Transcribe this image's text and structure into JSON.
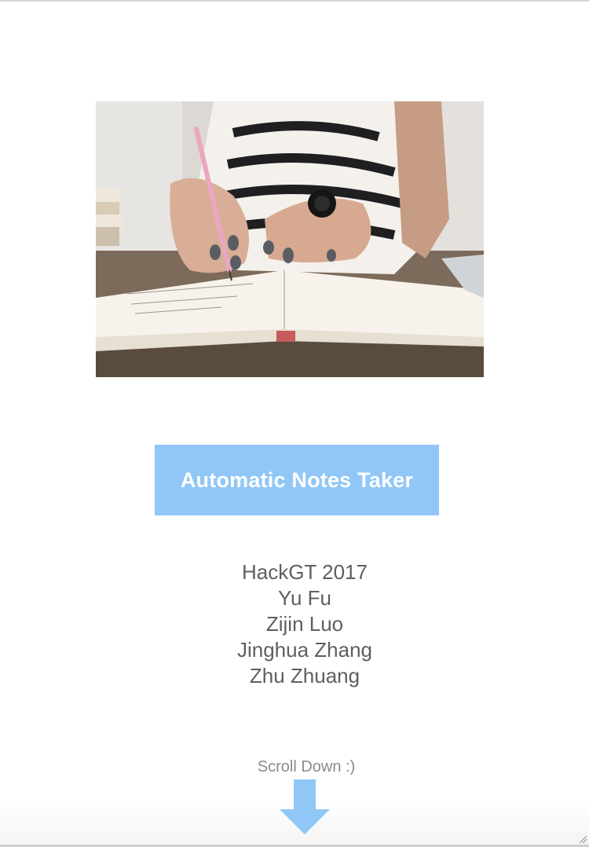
{
  "hero": {
    "image_alt": "Hand writing notes with a pink pen in an open notebook",
    "icon": "photo-notebook"
  },
  "title": {
    "label": "Automatic Notes Taker"
  },
  "credits": {
    "event": "HackGT 2017",
    "members": [
      "Yu Fu",
      "Zijin Luo",
      "Jinghua Zhang",
      "Zhu Zhuang"
    ]
  },
  "scroll": {
    "label": "Scroll Down :)",
    "icon": "down-arrow-icon"
  },
  "colors": {
    "accent": "#90c7f7",
    "title_text": "#ffffff",
    "body_text": "#5f5f5f",
    "hint_text": "#8a8a8a"
  }
}
